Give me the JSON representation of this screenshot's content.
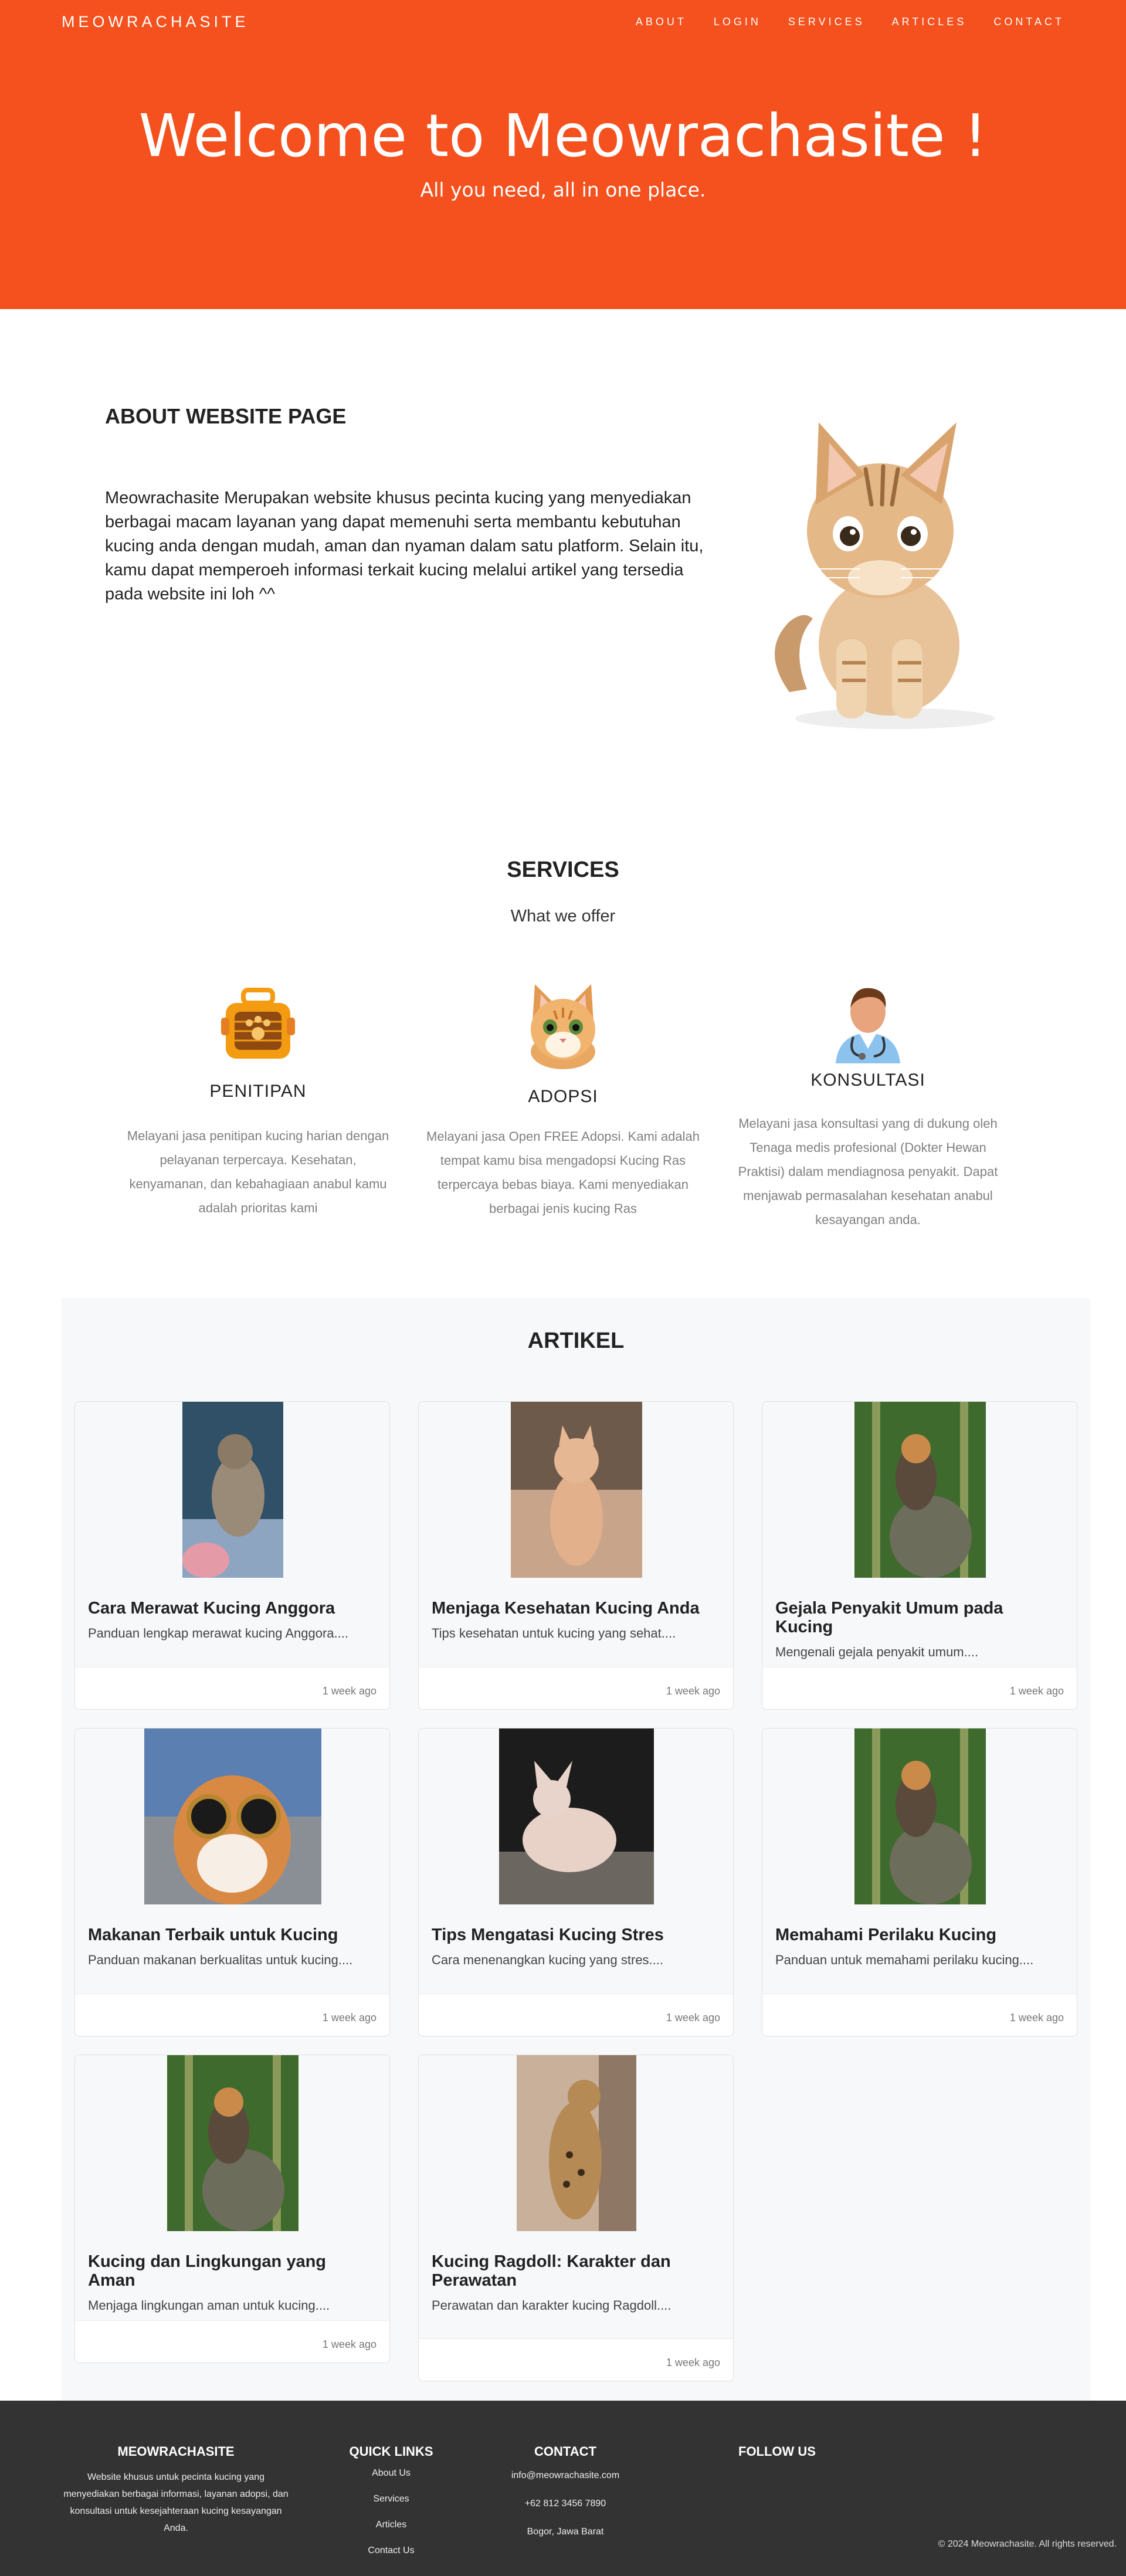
{
  "nav": {
    "brand": "MEOWRACHASITE",
    "items": [
      "ABOUT",
      "LOGIN",
      "SERVICES",
      "ARTICLES",
      "CONTACT"
    ]
  },
  "hero": {
    "title": "Welcome to Meowrachasite !",
    "subtitle": "All you need, all in one place."
  },
  "about": {
    "heading": "ABOUT WEBSITE PAGE",
    "text": "Meowrachasite Merupakan website khusus pecinta kucing yang menyediakan berbagai macam layanan yang dapat memenuhi serta membantu kebutuhan kucing anda dengan mudah, aman dan nyaman dalam satu platform. Selain itu, kamu dapat memperoeh informasi terkait kucing melalui artikel yang tersedia pada website ini loh ^^"
  },
  "services": {
    "heading": "SERVICES",
    "subheading": "What we offer",
    "items": [
      {
        "icon": "pet-carrier-icon",
        "title": "PENITIPAN",
        "desc": "Melayani jasa penitipan kucing harian dengan pelayanan terpercaya. Kesehatan, kenyamanan, dan kebahagiaan anabul kamu adalah prioritas kami"
      },
      {
        "icon": "kitten-icon",
        "title": "ADOPSI",
        "desc": "Melayani jasa Open FREE Adopsi. Kami adalah tempat kamu bisa mengadopsi Kucing Ras terpercaya bebas biaya. Kami menyediakan berbagai jenis kucing Ras"
      },
      {
        "icon": "doctor-icon",
        "title": "KONSULTASI",
        "desc": "Melayani jasa konsultasi yang di dukung oleh Tenaga medis profesional (Dokter Hewan Praktisi) dalam mendiagnosa penyakit. Dapat menjawab permasalahan kesehatan anabul kesayangan anda."
      }
    ]
  },
  "articles": {
    "heading": "ARTIKEL",
    "items": [
      {
        "title": "Cara Merawat Kucing Anggora",
        "excerpt": "Panduan lengkap merawat kucing Anggora....",
        "time": "1 week ago"
      },
      {
        "title": "Menjaga Kesehatan Kucing Anda",
        "excerpt": "Tips kesehatan untuk kucing yang sehat....",
        "time": "1 week ago"
      },
      {
        "title": "Gejala Penyakit Umum pada Kucing",
        "excerpt": "Mengenali gejala penyakit umum....",
        "time": "1 week ago"
      },
      {
        "title": "Makanan Terbaik untuk Kucing",
        "excerpt": "Panduan makanan berkualitas untuk kucing....",
        "time": "1 week ago"
      },
      {
        "title": "Tips Mengatasi Kucing Stres",
        "excerpt": "Cara menenangkan kucing yang stres....",
        "time": "1 week ago"
      },
      {
        "title": "Memahami Perilaku Kucing",
        "excerpt": "Panduan untuk memahami perilaku kucing....",
        "time": "1 week ago"
      },
      {
        "title": "Kucing dan Lingkungan yang Aman",
        "excerpt": "Menjaga lingkungan aman untuk kucing....",
        "time": "1 week ago"
      },
      {
        "title": "Kucing Ragdoll: Karakter dan Perawatan",
        "excerpt": "Perawatan dan karakter kucing Ragdoll....",
        "time": "1 week ago"
      }
    ]
  },
  "footer": {
    "about_heading": "MEOWRACHASITE",
    "about_text": "Website khusus untuk pecinta kucing yang menyediakan berbagai informasi, layanan adopsi, dan konsultasi untuk kesejahteraan kucing kesayangan Anda.",
    "links_heading": "QUICK LINKS",
    "links": [
      "About Us",
      "Services",
      "Articles",
      "Contact Us"
    ],
    "contact_heading": "CONTACT",
    "contact": [
      "info@meowrachasite.com",
      "+62 812 3456 7890",
      "Bogor, Jawa Barat"
    ],
    "follow_heading": "FOLLOW US",
    "copyright": "© 2024 Meowrachasite. All rights reserved."
  },
  "colors": {
    "brand": "#f4511e",
    "articles_bg": "#f6f8fa",
    "footer_bg": "#333333"
  }
}
